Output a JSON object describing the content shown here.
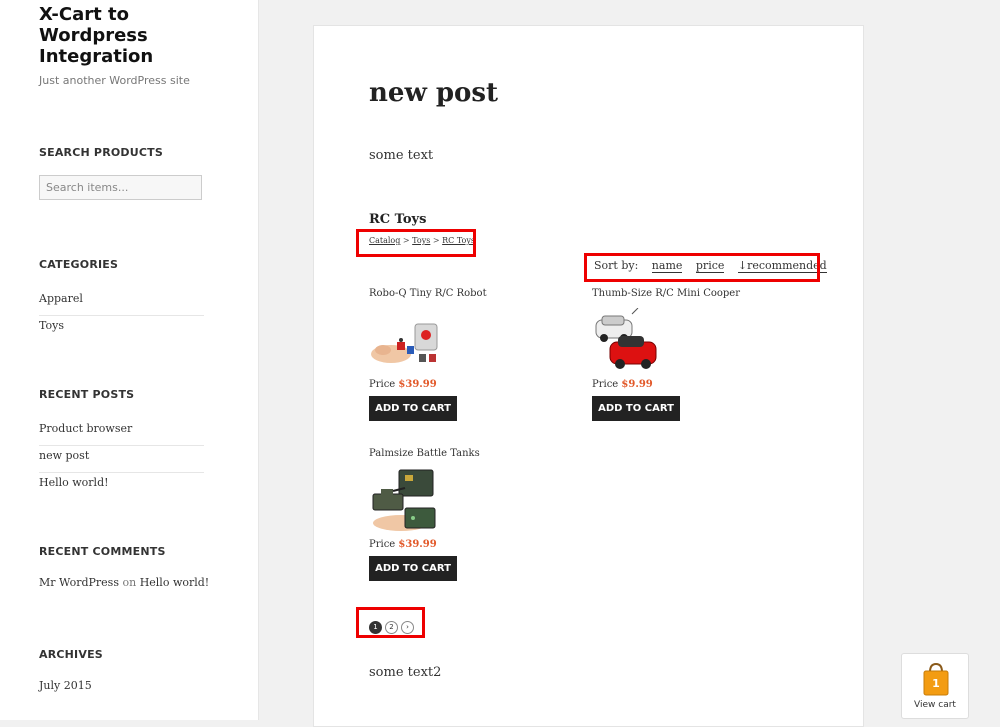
{
  "site": {
    "title": "X-Cart to Wordpress Integration",
    "description": "Just another WordPress site"
  },
  "sidebar": {
    "search": {
      "title": "SEARCH PRODUCTS",
      "placeholder": "Search items..."
    },
    "categories": {
      "title": "CATEGORIES",
      "items": [
        "Apparel",
        "Toys"
      ]
    },
    "recent_posts": {
      "title": "RECENT POSTS",
      "items": [
        "Product browser",
        "new post",
        "Hello world!"
      ]
    },
    "recent_comments": {
      "title": "RECENT COMMENTS",
      "author": "Mr WordPress",
      "on": "on",
      "post": "Hello world!"
    },
    "archives": {
      "title": "ARCHIVES",
      "items": [
        "July 2015"
      ]
    }
  },
  "post": {
    "title": "new post",
    "text1": "some text",
    "text2": "some text2",
    "category_title": "RC Toys",
    "breadcrumb": {
      "items": [
        "Catalog",
        "Toys",
        "RC Toys"
      ],
      "separator": ">"
    },
    "sort": {
      "label": "Sort by:",
      "options": [
        "name",
        "price",
        "↓recommended"
      ]
    },
    "products": [
      {
        "name": "Robo-Q Tiny R/C Robot",
        "price_label": "Price",
        "price": "$39.99",
        "button": "ADD TO CART"
      },
      {
        "name": "Thumb-Size R/C Mini Cooper",
        "price_label": "Price",
        "price": "$9.99",
        "button": "ADD TO CART"
      },
      {
        "name": "Palmsize Battle Tanks",
        "price_label": "Price",
        "price": "$39.99",
        "button": "ADD TO CART"
      }
    ],
    "pagination": {
      "pages": [
        "1",
        "2"
      ],
      "next": "›",
      "current": "1"
    }
  },
  "cart_widget": {
    "label": "View cart",
    "count": "1"
  },
  "colors": {
    "price": "#e2592a",
    "button_bg": "#222222",
    "highlight": "#ee0000"
  }
}
